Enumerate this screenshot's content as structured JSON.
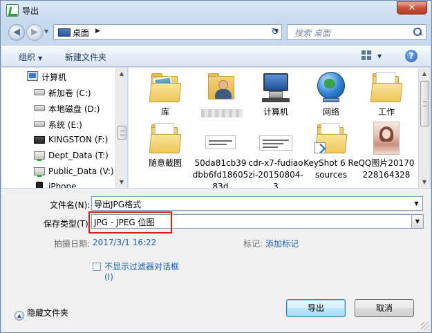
{
  "window": {
    "title": "导出",
    "close_label": "✕"
  },
  "address": {
    "path": "桌面",
    "search_placeholder": "搜索 桌面"
  },
  "toolbar": {
    "organize_label": "组织",
    "new_folder_label": "新建文件夹"
  },
  "nav": {
    "items": [
      {
        "label": "计算机",
        "icon": "computer-icon"
      },
      {
        "label": "新加卷 (C:)",
        "icon": "drive-icon"
      },
      {
        "label": "本地磁盘 (D:)",
        "icon": "drive-icon"
      },
      {
        "label": "系统 (E:)",
        "icon": "drive-icon"
      },
      {
        "label": "KINGSTON (F:)",
        "icon": "usb-drive-icon"
      },
      {
        "label": "Dept_Data (T:)",
        "icon": "network-drive-icon"
      },
      {
        "label": "Public_Data (V:)",
        "icon": "network-drive-icon"
      },
      {
        "label": "iPhone",
        "icon": "phone-icon"
      }
    ]
  },
  "files": {
    "items": [
      {
        "label": "库",
        "icon": "library-folder-icon"
      },
      {
        "label": "",
        "icon": "user-folder-icon"
      },
      {
        "label": "计算机",
        "icon": "computer-icon"
      },
      {
        "label": "网络",
        "icon": "network-globe-icon"
      },
      {
        "label": "工作",
        "icon": "folder-icon"
      },
      {
        "label": "随意截图",
        "icon": "folder-icon"
      },
      {
        "label": "50da81cb39dbb6fd1860583d",
        "icon": "image-file-icon"
      },
      {
        "label": "cdr-x7-fudiaozi-20150804-3",
        "icon": "file-icon"
      },
      {
        "label": "KeyShot 6 Resources",
        "icon": "shortcut-folder-icon"
      },
      {
        "label": "QQ图片20170228164328",
        "icon": "photo-thumbnail-icon"
      }
    ]
  },
  "form": {
    "filename_label": "文件名(N):",
    "filename_value": "导出JPG格式",
    "filetype_label": "保存类型(T):",
    "filetype_value": "JPG - JPEG 位图",
    "date_label": "拍摄日期:",
    "date_value": "2017/3/1 16:22",
    "tags_label": "标记:",
    "tags_value": "添加标记",
    "checkbox_label": "不显示过滤器对话框",
    "checkbox_label_line2": "(I)",
    "checkbox_checked": false
  },
  "footer": {
    "hide_folders_label": "隐藏文件夹",
    "export_button": "导出",
    "cancel_button": "取消"
  },
  "colors": {
    "highlight_border": "#e01a1a",
    "link_blue": "#1f5fae",
    "default_button_border": "#3c7fb1"
  }
}
